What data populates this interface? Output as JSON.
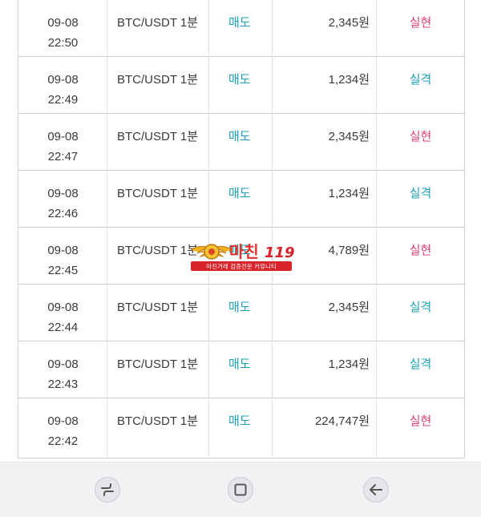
{
  "trades": [
    {
      "date": "09-08",
      "time": "22:50",
      "pair": "BTC/USDT 1분",
      "side": "매도",
      "amount": "2,345원",
      "result": "실현",
      "result_color": "#e0407a"
    },
    {
      "date": "09-08",
      "time": "22:49",
      "pair": "BTC/USDT 1분",
      "side": "매도",
      "amount": "1,234원",
      "result": "실격",
      "result_color": "#1aa0b8"
    },
    {
      "date": "09-08",
      "time": "22:47",
      "pair": "BTC/USDT 1분",
      "side": "매도",
      "amount": "2,345원",
      "result": "실현",
      "result_color": "#e0407a"
    },
    {
      "date": "09-08",
      "time": "22:46",
      "pair": "BTC/USDT 1분",
      "side": "매도",
      "amount": "1,234원",
      "result": "실격",
      "result_color": "#1aa0b8"
    },
    {
      "date": "09-08",
      "time": "22:45",
      "pair": "BTC/USDT 1분",
      "side": "매도",
      "amount": "4,789원",
      "result": "실현",
      "result_color": "#e0407a"
    },
    {
      "date": "09-08",
      "time": "22:44",
      "pair": "BTC/USDT 1분",
      "side": "매도",
      "amount": "2,345원",
      "result": "실격",
      "result_color": "#1aa0b8"
    },
    {
      "date": "09-08",
      "time": "22:43",
      "pair": "BTC/USDT 1분",
      "side": "매도",
      "amount": "1,234원",
      "result": "실격",
      "result_color": "#1aa0b8"
    },
    {
      "date": "09-08",
      "time": "22:42",
      "pair": "BTC/USDT 1분",
      "side": "매도",
      "amount": "224,747원",
      "result": "실현",
      "result_color": "#e0407a"
    }
  ],
  "watermark": {
    "brand": "마친",
    "number": "119",
    "tagline": "마진거래 검증전문 커뮤니티"
  },
  "navbar": {
    "recent_icon": "recent-apps-icon",
    "home_icon": "home-square-icon",
    "back_icon": "back-arrow-icon"
  }
}
